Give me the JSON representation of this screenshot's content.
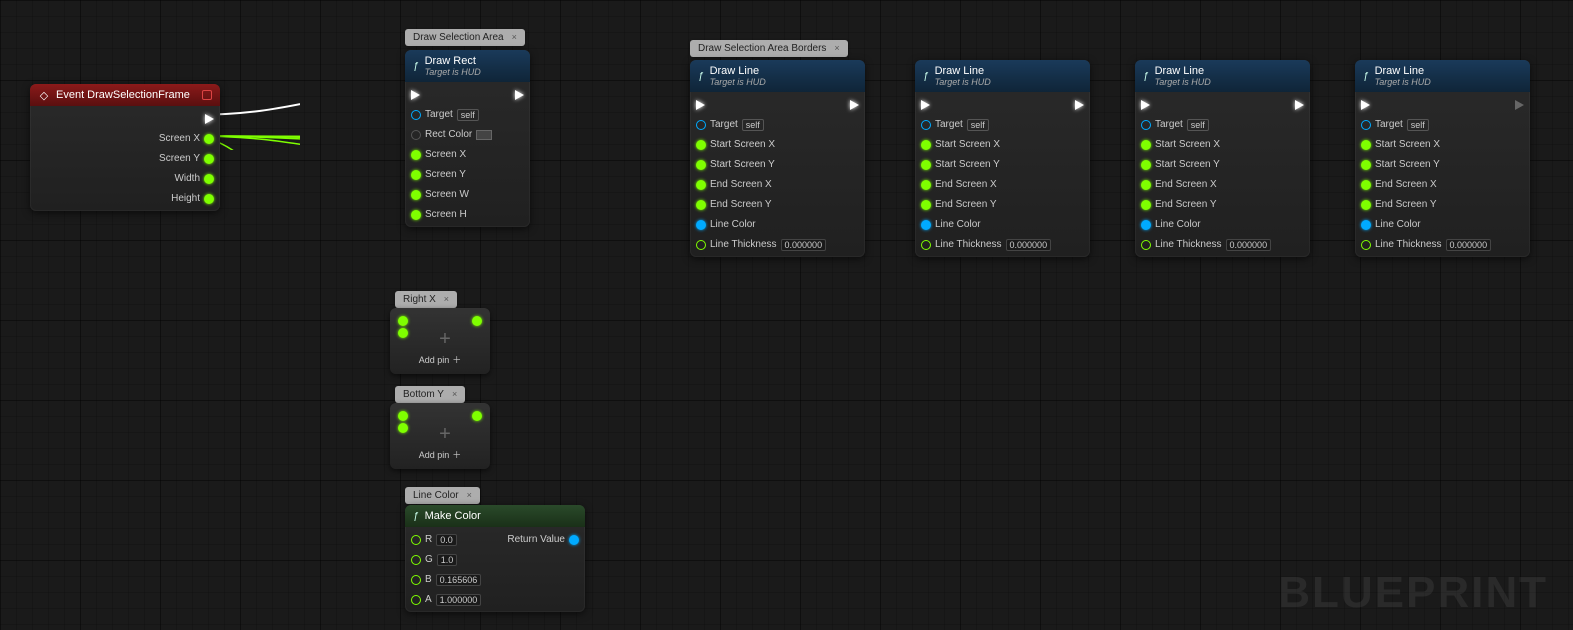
{
  "watermark": "BLUEPRINT",
  "comments": [
    "Draw Selection Area",
    "Draw Selection Area Borders",
    "Right X",
    "Bottom Y",
    "Line Color"
  ],
  "common": {
    "target": "Target",
    "self": "self",
    "addpin": "Add pin"
  },
  "nodes": {
    "event": {
      "title": "Event DrawSelectionFrame",
      "outputs": [
        "Screen X",
        "Screen Y",
        "Width",
        "Height"
      ]
    },
    "drawrect": {
      "title": "Draw Rect",
      "subtitle": "Target is HUD",
      "inputs": [
        "Target",
        "Rect Color",
        "Screen X",
        "Screen Y",
        "Screen W",
        "Screen H"
      ]
    },
    "drawline": {
      "title": "Draw Line",
      "subtitle": "Target is HUD",
      "inputs": [
        "Target",
        "Start Screen X",
        "Start Screen Y",
        "End Screen X",
        "End Screen Y",
        "Line Color",
        "Line Thickness"
      ],
      "thickness": "0.000000",
      "positions": [
        690,
        915,
        1135,
        1355
      ]
    },
    "makecolor": {
      "title": "Make Color",
      "inputs": [
        "R",
        "G",
        "B",
        "A"
      ],
      "values": [
        "0.0",
        "1.0",
        "0.165606",
        "1.000000"
      ],
      "output": "Return Value"
    }
  }
}
